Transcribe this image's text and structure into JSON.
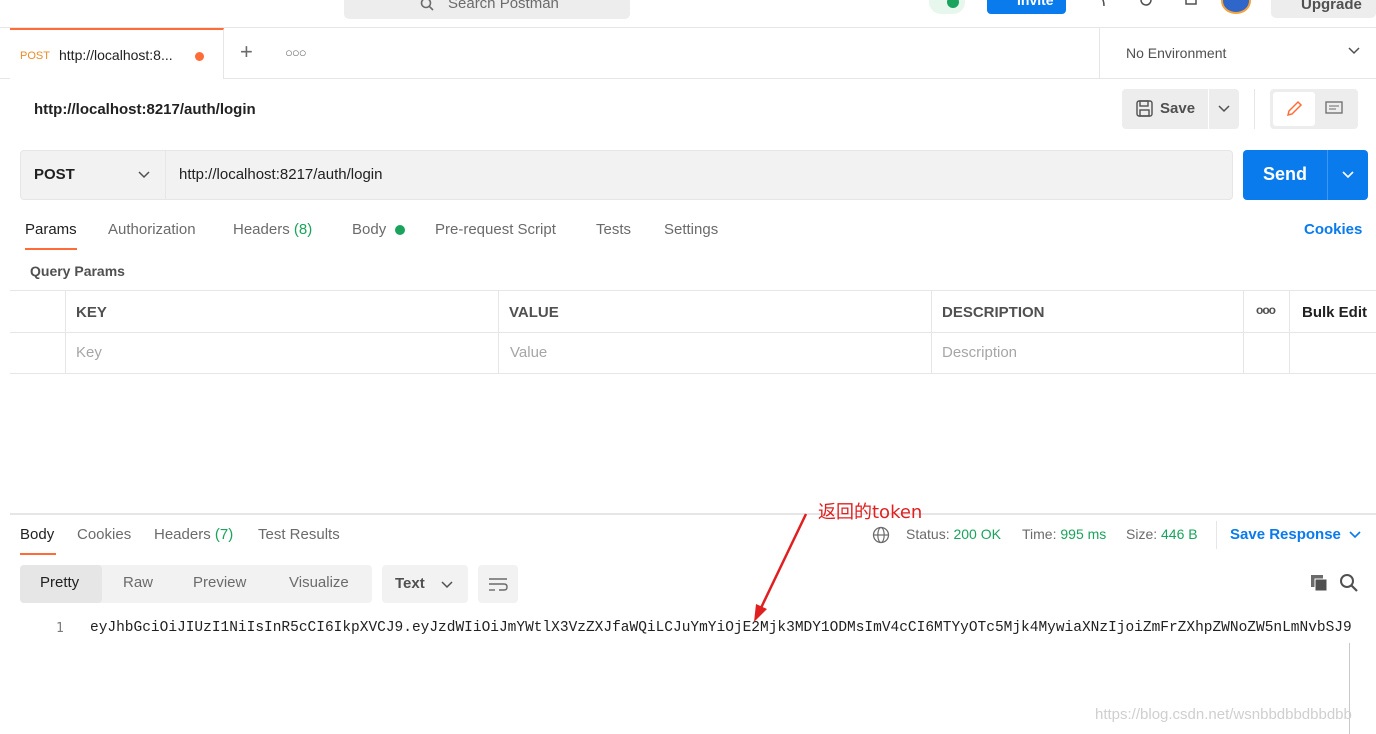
{
  "header": {
    "search_placeholder": "Search Postman",
    "invite_label": "Invite",
    "upgrade_label": "Upgrade"
  },
  "tabs": [
    {
      "method": "POST",
      "title": "http://localhost:8..."
    }
  ],
  "environment": {
    "label": "No Environment"
  },
  "request": {
    "title": "http://localhost:8217/auth/login",
    "save_label": "Save",
    "method": "POST",
    "url": "http://localhost:8217/auth/login",
    "send_label": "Send"
  },
  "request_tabs": {
    "params": "Params",
    "authorization": "Authorization",
    "headers": "Headers",
    "headers_count": "(8)",
    "body": "Body",
    "pre_request": "Pre-request Script",
    "tests": "Tests",
    "settings": "Settings",
    "cookies": "Cookies"
  },
  "query_params": {
    "title": "Query Params",
    "columns": [
      "KEY",
      "VALUE",
      "DESCRIPTION"
    ],
    "bulk_edit": "Bulk Edit",
    "placeholders": [
      "Key",
      "Value",
      "Description"
    ]
  },
  "response": {
    "tabs": {
      "body": "Body",
      "cookies": "Cookies",
      "headers": "Headers",
      "headers_count": "(7)",
      "test_results": "Test Results"
    },
    "status_label": "Status:",
    "status_value": "200 OK",
    "time_label": "Time:",
    "time_value": "995 ms",
    "size_label": "Size:",
    "size_value": "446 B",
    "save_response": "Save Response",
    "format_options": [
      "Pretty",
      "Raw",
      "Preview",
      "Visualize"
    ],
    "selected_format": "Pretty",
    "text_type": "Text",
    "line_number": "1",
    "body_text": "eyJhbGciOiJIUzI1NiIsInR5cCI6IkpXVCJ9.eyJzdWIiOiJmYWtlX3VzZXJfaWQiLCJuYmYiOjE2Mjk3MDY1ODMsImV4cCI6MTYyOTc5Mjk4MywiaXNzIjoiZmFrZXhpZWNoZW5nLmNvbSJ9"
  },
  "annotation": {
    "text": "返回的token",
    "color": "#e02020"
  },
  "watermark": "https://blog.csdn.net/wsnbbdbbdbbdbb",
  "colors": {
    "accent_orange": "#ff6c37",
    "primary_blue": "#097bed",
    "success_green": "#1aa35c"
  }
}
